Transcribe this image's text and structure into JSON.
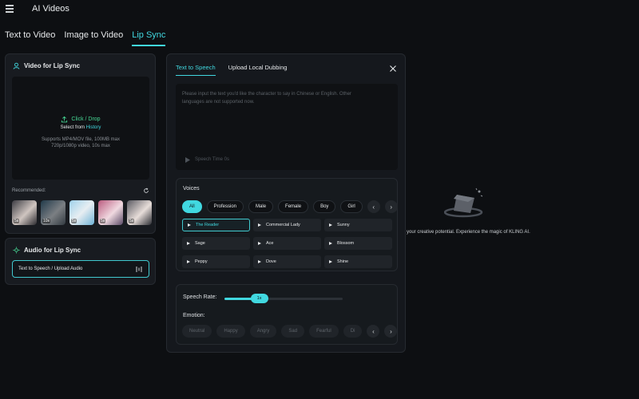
{
  "app": {
    "title": "AI Videos"
  },
  "tabs": [
    {
      "label": "Text to Video"
    },
    {
      "label": "Image to Video"
    },
    {
      "label": "Lip Sync",
      "active": true
    }
  ],
  "video_panel": {
    "title": "Video for Lip Sync",
    "upload_label": "Click / Drop",
    "select_prefix": "Select from",
    "select_link": "History",
    "note_line1": "Supports MP4/MOV file, 100MB max",
    "note_line2": "720p/1080p video, 10s max",
    "recommended_label": "Recommended:",
    "thumbnails": [
      {
        "duration": "5s"
      },
      {
        "duration": "10s"
      },
      {
        "duration": "5s"
      },
      {
        "duration": "5s"
      },
      {
        "duration": "5s"
      }
    ]
  },
  "audio_panel": {
    "title": "Audio for Lip Sync",
    "button_label": "Text to Speech / Upload Audio"
  },
  "modal": {
    "tabs": [
      {
        "label": "Text to Speech",
        "active": true
      },
      {
        "label": "Upload Local Dubbing"
      }
    ],
    "textarea_placeholder_line1": "Please input the text you'd like the character to say in Chinese or English. Other",
    "textarea_placeholder_line2": "languages are not supported now.",
    "speech_time": "Speech Time 0s",
    "voices_label": "Voices",
    "voice_filters": [
      "All",
      "Profession",
      "Male",
      "Female",
      "Boy",
      "Girl"
    ],
    "voices": [
      {
        "name": "The Reader",
        "active": true
      },
      {
        "name": "Commercial Lady"
      },
      {
        "name": "Sunny"
      },
      {
        "name": "Sage"
      },
      {
        "name": "Ace"
      },
      {
        "name": "Blossom"
      },
      {
        "name": "Peppy"
      },
      {
        "name": "Dove"
      },
      {
        "name": "Shine"
      }
    ],
    "speech_rate_label": "Speech Rate:",
    "speech_rate_value": "1x",
    "speech_rate_fraction": 0.22,
    "emotion_label": "Emotion:",
    "emotions": [
      "Neutral",
      "Happy",
      "Angry",
      "Sad",
      "Fearful",
      "Di"
    ]
  },
  "background": {
    "tagline": "your creative potential. Experience the magic of KLING AI."
  },
  "colors": {
    "accent": "#41d8e0",
    "upload_green": "#46d694",
    "background": "#0d0f12",
    "panel": "#181b20"
  }
}
